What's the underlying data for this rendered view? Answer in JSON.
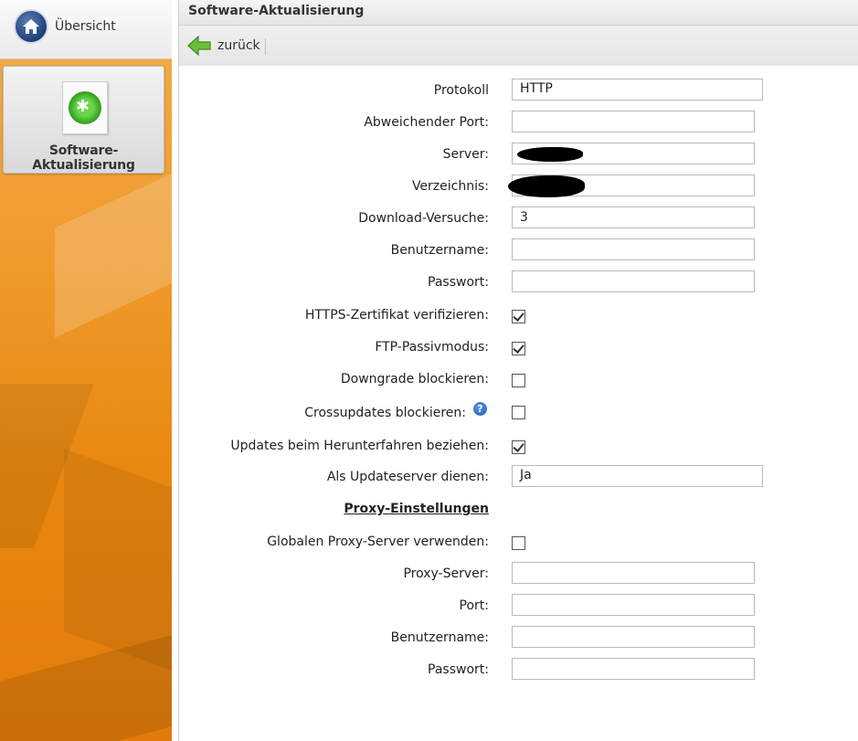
{
  "sidebar": {
    "home_label": "Übersicht",
    "app_tile_label": "Software-Aktualisierung"
  },
  "header": {
    "title": "Software-Aktualisierung",
    "back_label": "zurück"
  },
  "form": {
    "protokoll": {
      "label": "Protokoll",
      "value": "HTTP"
    },
    "abw_port": {
      "label": "Abweichender Port:",
      "value": ""
    },
    "server": {
      "label": "Server:",
      "value": ""
    },
    "verzeichnis": {
      "label": "Verzeichnis:",
      "value": ""
    },
    "download_versuche": {
      "label": "Download-Versuche:",
      "value": "3"
    },
    "benutzername": {
      "label": "Benutzername:",
      "value": ""
    },
    "passwort": {
      "label": "Passwort:",
      "value": ""
    },
    "https_verify": {
      "label": "HTTPS-Zertifikat verifizieren:",
      "checked": true
    },
    "ftp_passiv": {
      "label": "FTP-Passivmodus:",
      "checked": true
    },
    "downgrade": {
      "label": "Downgrade blockieren:",
      "checked": false
    },
    "crossupdates": {
      "label": "Crossupdates blockieren:",
      "checked": false
    },
    "updates_shutdown": {
      "label": "Updates beim Herunterfahren beziehen:",
      "checked": true
    },
    "updateserver": {
      "label": "Als Updateserver dienen:",
      "value": "Ja"
    }
  },
  "proxy": {
    "heading": "Proxy-Einstellungen",
    "global_proxy": {
      "label": "Globalen Proxy-Server verwenden:",
      "checked": false
    },
    "proxy_server": {
      "label": "Proxy-Server:",
      "value": ""
    },
    "port": {
      "label": "Port:",
      "value": ""
    },
    "benutzername": {
      "label": "Benutzername:",
      "value": ""
    },
    "passwort": {
      "label": "Passwort:",
      "value": ""
    }
  },
  "icons": {
    "home": "home-icon",
    "back": "back-arrow-icon",
    "app": "software-update-icon",
    "help": "help-icon"
  },
  "colors": {
    "sidebar_orange": "#ef9a2c",
    "back_arrow_green": "#5aa52f",
    "help_blue": "#1b5bbf"
  }
}
